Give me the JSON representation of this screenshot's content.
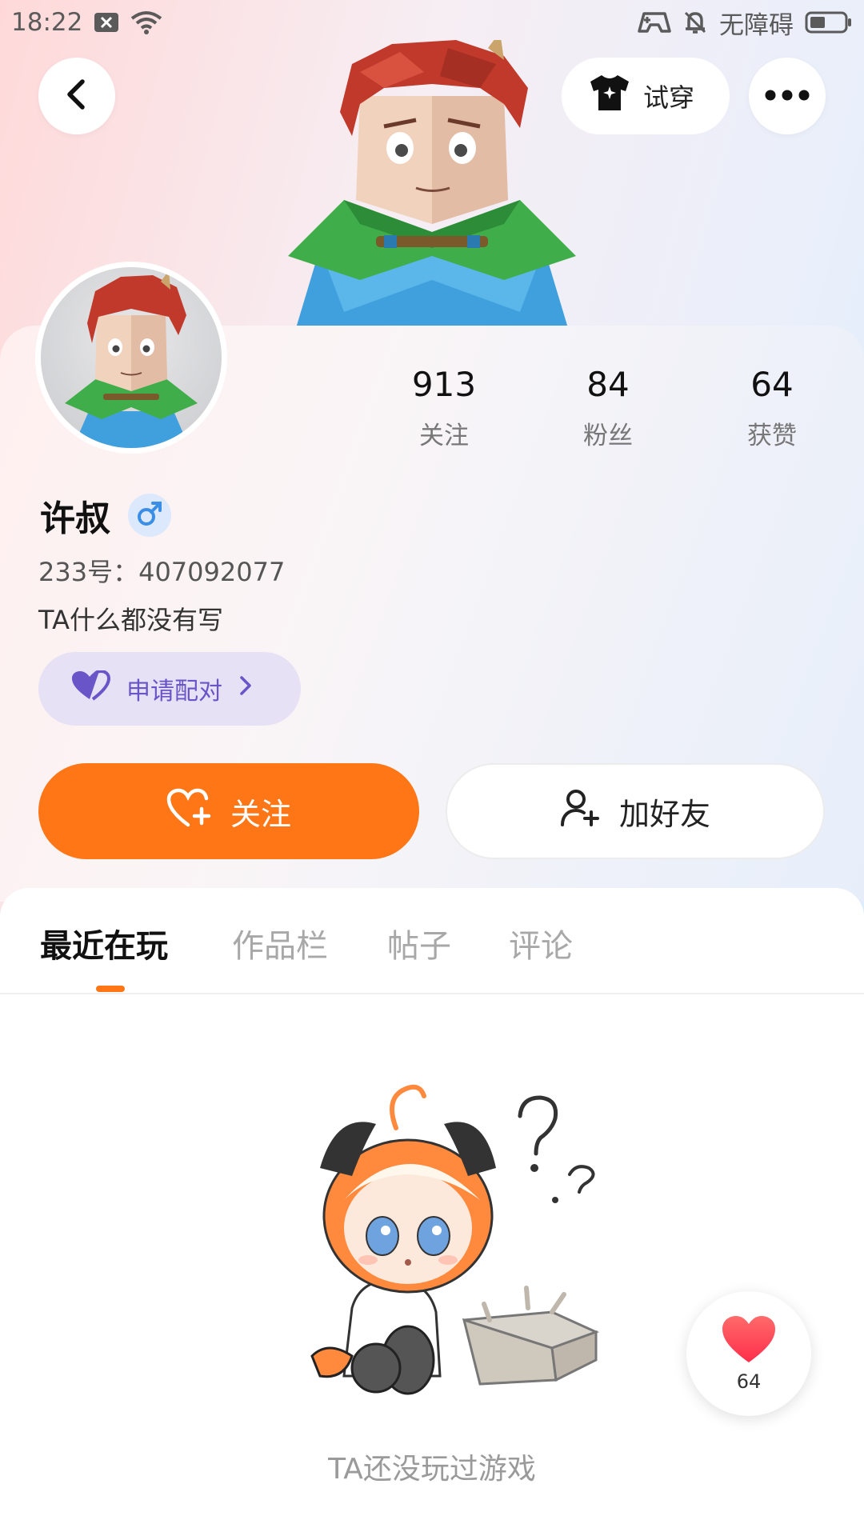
{
  "status_bar": {
    "time": "18:22",
    "accessibility_label": "无障碍",
    "icons": [
      "close-box-icon",
      "wifi-icon",
      "game-controller-icon",
      "bell-off-icon",
      "battery-icon"
    ]
  },
  "header": {
    "try_on_label": "试穿",
    "icons": [
      "back-icon",
      "shirt-icon",
      "more-icon"
    ]
  },
  "profile": {
    "stats": [
      {
        "value": "913",
        "label": "关注"
      },
      {
        "value": "84",
        "label": "粉丝"
      },
      {
        "value": "64",
        "label": "获赞"
      }
    ],
    "username": "许叔",
    "gender_symbol": "♂",
    "uid_line": "233号：407092077",
    "bio": "TA什么都没有写",
    "pair_label": "申请配对"
  },
  "actions": {
    "follow_label": "关注",
    "add_friend_label": "加好友"
  },
  "tabs": [
    {
      "label": "最近在玩",
      "active": true
    },
    {
      "label": "作品栏",
      "active": false
    },
    {
      "label": "帖子",
      "active": false
    },
    {
      "label": "评论",
      "active": false
    }
  ],
  "empty_state": {
    "message": "TA还没玩过游戏"
  },
  "like_fab": {
    "count": "64"
  },
  "colors": {
    "accent": "#ff7617",
    "pair_purple": "#6a55c8",
    "gender_blue": "#3a8ee6",
    "like_red": "#ff3b4a"
  }
}
